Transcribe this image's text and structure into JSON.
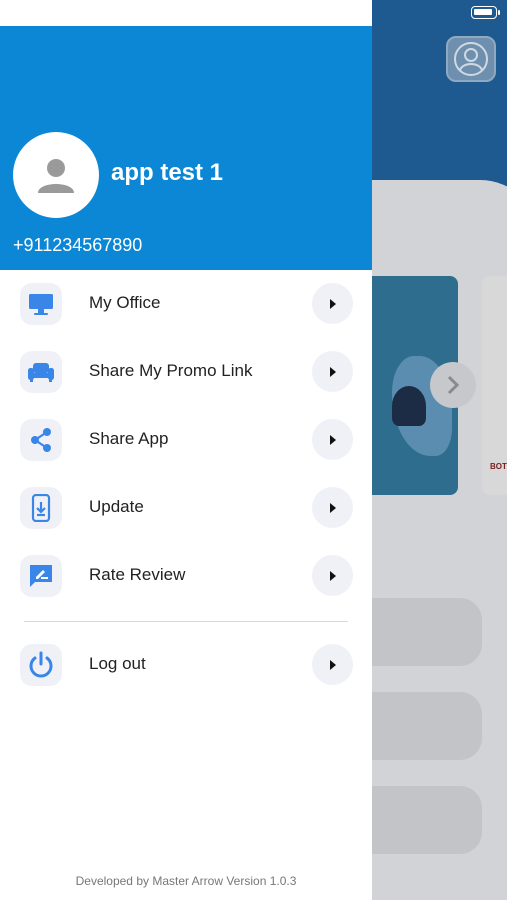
{
  "header": {
    "user_name": "app test 1",
    "phone": "+911234567890"
  },
  "menu": {
    "items": [
      {
        "label": "My Office",
        "icon": "monitor-icon"
      },
      {
        "label": "Share My Promo Link",
        "icon": "sofa-icon"
      },
      {
        "label": "Share App",
        "icon": "share-icon"
      },
      {
        "label": "Update",
        "icon": "phone-download-icon"
      },
      {
        "label": "Rate Review",
        "icon": "rate-review-icon"
      }
    ],
    "logout": {
      "label": "Log out",
      "icon": "power-icon"
    }
  },
  "footer": {
    "text": "Developed by Master Arrow  Version 1.0.3"
  },
  "colors": {
    "accent": "#0b87d6",
    "icon_blue": "#3a86e8",
    "background_header": "#1e5a8f"
  }
}
